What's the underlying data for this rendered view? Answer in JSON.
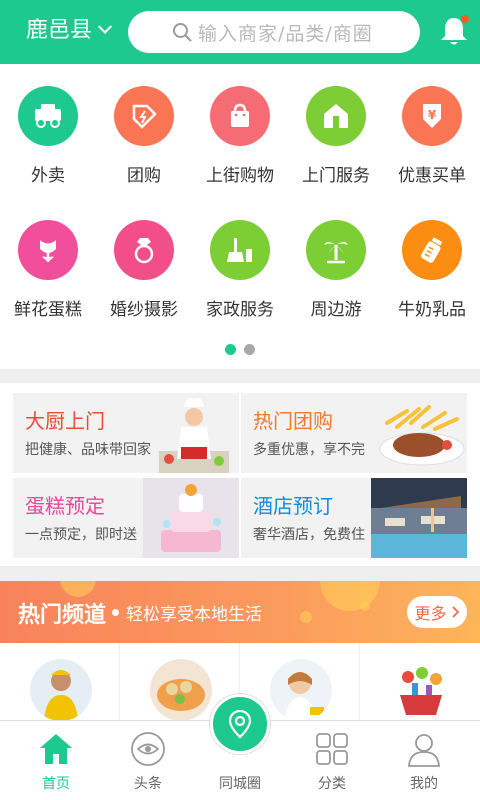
{
  "header": {
    "city": "鹿邑县",
    "search_placeholder": "输入商家/品类/商圈"
  },
  "categories": [
    {
      "label": "外卖",
      "icon": "delivery-truck-icon",
      "color": "#1ec98f"
    },
    {
      "label": "团购",
      "icon": "coupon-tag-icon",
      "color": "#fa7554"
    },
    {
      "label": "上街购物",
      "icon": "shopping-bag-icon",
      "color": "#f66c74"
    },
    {
      "label": "上门服务",
      "icon": "home-icon",
      "color": "#7dcd35"
    },
    {
      "label": "优惠买单",
      "icon": "yen-discount-icon",
      "color": "#fa7554"
    },
    {
      "label": "鲜花蛋糕",
      "icon": "tulip-icon",
      "color": "#f14e9c"
    },
    {
      "label": "婚纱摄影",
      "icon": "diamond-ring-icon",
      "color": "#f24e88"
    },
    {
      "label": "家政服务",
      "icon": "broom-icon",
      "color": "#7dcd35"
    },
    {
      "label": "周边游",
      "icon": "palm-tree-icon",
      "color": "#7dcd35"
    },
    {
      "label": "牛奶乳品",
      "icon": "milk-bottle-icon",
      "color": "#fb8d12"
    }
  ],
  "pager": {
    "count": 2,
    "active": 0
  },
  "promos": [
    {
      "title": "大厨上门",
      "subtitle": "把健康、品味带回家",
      "color": "#e84b38"
    },
    {
      "title": "热门团购",
      "subtitle": "多重优惠，享不完",
      "color": "#f27a2d"
    },
    {
      "title": "蛋糕预定",
      "subtitle": "一点预定，即时送",
      "color": "#e8489b"
    },
    {
      "title": "酒店预订",
      "subtitle": "奢华酒店，免费住",
      "color": "#0e8fd8"
    }
  ],
  "hot_channel": {
    "title": "热门频道",
    "subtitle": "轻松享受本地生活",
    "more": "更多"
  },
  "nav": [
    {
      "label": "首页",
      "icon": "home-icon",
      "active": true
    },
    {
      "label": "头条",
      "icon": "eye-icon",
      "active": false
    },
    {
      "label": "同城圈",
      "icon": "location-pin-icon",
      "active": false
    },
    {
      "label": "分类",
      "icon": "grid-icon",
      "active": false
    },
    {
      "label": "我的",
      "icon": "user-icon",
      "active": false
    }
  ],
  "colors": {
    "brand": "#1ec98f",
    "banner": "#f9825c"
  }
}
